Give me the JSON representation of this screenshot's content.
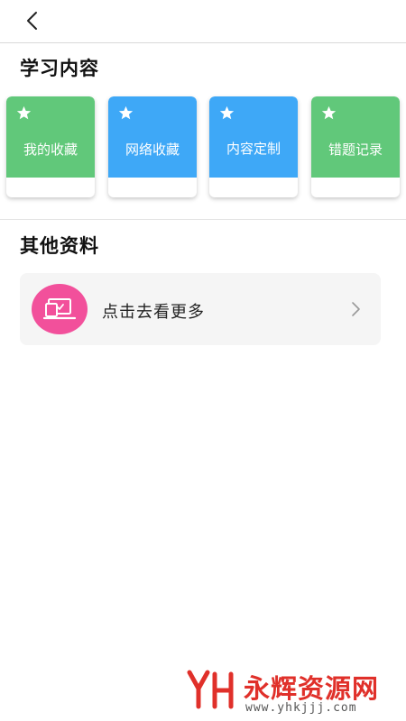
{
  "header": {
    "back_icon": "chevron-left-icon"
  },
  "sections": {
    "study_content": {
      "title": "学习内容",
      "cards": [
        {
          "label": "我的收藏",
          "color": "#61c87a",
          "icon": "star-icon"
        },
        {
          "label": "网络收藏",
          "color": "#3ea8f7",
          "icon": "star-icon"
        },
        {
          "label": "内容定制",
          "color": "#3ea8f7",
          "icon": "star-icon"
        },
        {
          "label": "错题记录",
          "color": "#61c87a",
          "icon": "star-icon"
        }
      ]
    },
    "other_materials": {
      "title": "其他资料",
      "item": {
        "label": "点击去看更多",
        "icon": "laptop-icon",
        "avatar_color": "#f2509b",
        "chevron_icon": "chevron-right-icon"
      }
    }
  },
  "watermark": {
    "name": "永辉资源网",
    "url": "www.yhkjjj.com",
    "brand_color": "#e0302a"
  }
}
